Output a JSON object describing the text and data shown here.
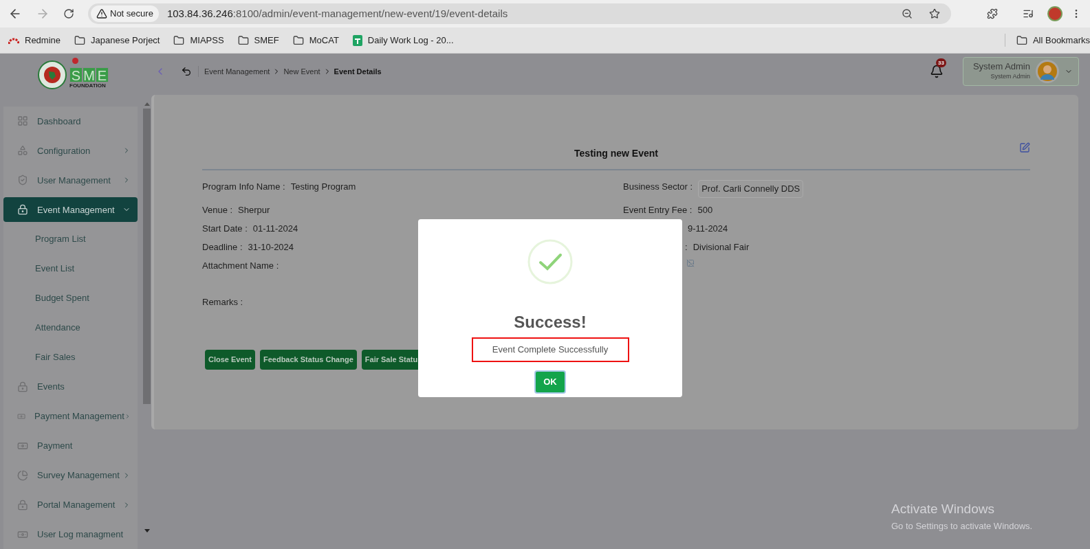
{
  "browser": {
    "security": "Not secure",
    "url_host": "103.84.36.246",
    "url_rest": ":8100/admin/event-management/new-event/19/event-details",
    "bookmarks": [
      {
        "kind": "redmine",
        "label": "Redmine"
      },
      {
        "kind": "folder",
        "label": "Japanese Porject"
      },
      {
        "kind": "folder",
        "label": "MIAPSS"
      },
      {
        "kind": "folder",
        "label": "SMEF"
      },
      {
        "kind": "folder",
        "label": "MoCAT"
      },
      {
        "kind": "sheet",
        "label": "Daily Work Log - 20..."
      }
    ],
    "all_bookmarks": "All Bookmarks"
  },
  "logo": {
    "letters": [
      "S",
      "M",
      "E"
    ],
    "subtitle": "FOUNDATION"
  },
  "breadcrumbs": [
    {
      "label": "Event Management",
      "current": false
    },
    {
      "label": "New Event",
      "current": false
    },
    {
      "label": "Event Details",
      "current": true
    }
  ],
  "notifications": {
    "count": "33"
  },
  "user": {
    "name": "System Admin",
    "role": "System Admin"
  },
  "sidebar": {
    "items": [
      {
        "kind": "link",
        "label": "Dashboard",
        "selected": false
      },
      {
        "kind": "menu",
        "label": "Configuration",
        "selected": false,
        "expanded": false
      },
      {
        "kind": "menu",
        "label": "User Management",
        "selected": false,
        "expanded": false
      },
      {
        "kind": "menu",
        "label": "Event Management",
        "selected": true,
        "expanded": true,
        "children": [
          {
            "label": "Program List"
          },
          {
            "label": "Event List"
          },
          {
            "label": "Budget Spent"
          },
          {
            "label": "Attendance"
          },
          {
            "label": "Fair Sales"
          }
        ]
      },
      {
        "kind": "link",
        "label": "Events",
        "selected": false
      },
      {
        "kind": "menu",
        "label": "Payment Management",
        "selected": false,
        "expanded": false
      },
      {
        "kind": "link",
        "label": "Payment",
        "selected": false
      },
      {
        "kind": "menu",
        "label": "Survey Management",
        "selected": false,
        "expanded": false
      },
      {
        "kind": "menu",
        "label": "Portal Management",
        "selected": false,
        "expanded": false
      },
      {
        "kind": "link",
        "label": "User Log managment",
        "selected": false
      }
    ]
  },
  "event": {
    "title": "Testing new Event",
    "left_fields": [
      {
        "label": "Program Info Name :",
        "value": "Testing Program"
      },
      {
        "label": "Venue :",
        "value": "Sherpur"
      },
      {
        "label": "Start Date :",
        "value": "01-11-2024"
      },
      {
        "label": "Deadline :",
        "value": "31-10-2024"
      },
      {
        "label": "Attachment Name :"
      }
    ],
    "remarks_label": "Remarks :",
    "right_fields": [
      {
        "kind": "chip",
        "label": "Business Sector :",
        "value": "Prof. Carli Connelly DDS"
      },
      {
        "kind": "text",
        "label": "Event Entry Fee :",
        "value": "500"
      },
      {
        "kind": "partial",
        "value": "9-11-2024"
      },
      {
        "kind": "partial",
        "label": ":",
        "value": "Divisional Fair"
      },
      {
        "kind": "image"
      }
    ],
    "actions": [
      "Close Event",
      "Feedback Status Change",
      "Fair Sale Statu"
    ]
  },
  "dialog": {
    "title": "Success!",
    "message": "Event Complete Successfully",
    "button": "OK"
  },
  "os_notice": {
    "title": "Activate Windows",
    "subtitle": "Go to Settings to activate Windows."
  }
}
